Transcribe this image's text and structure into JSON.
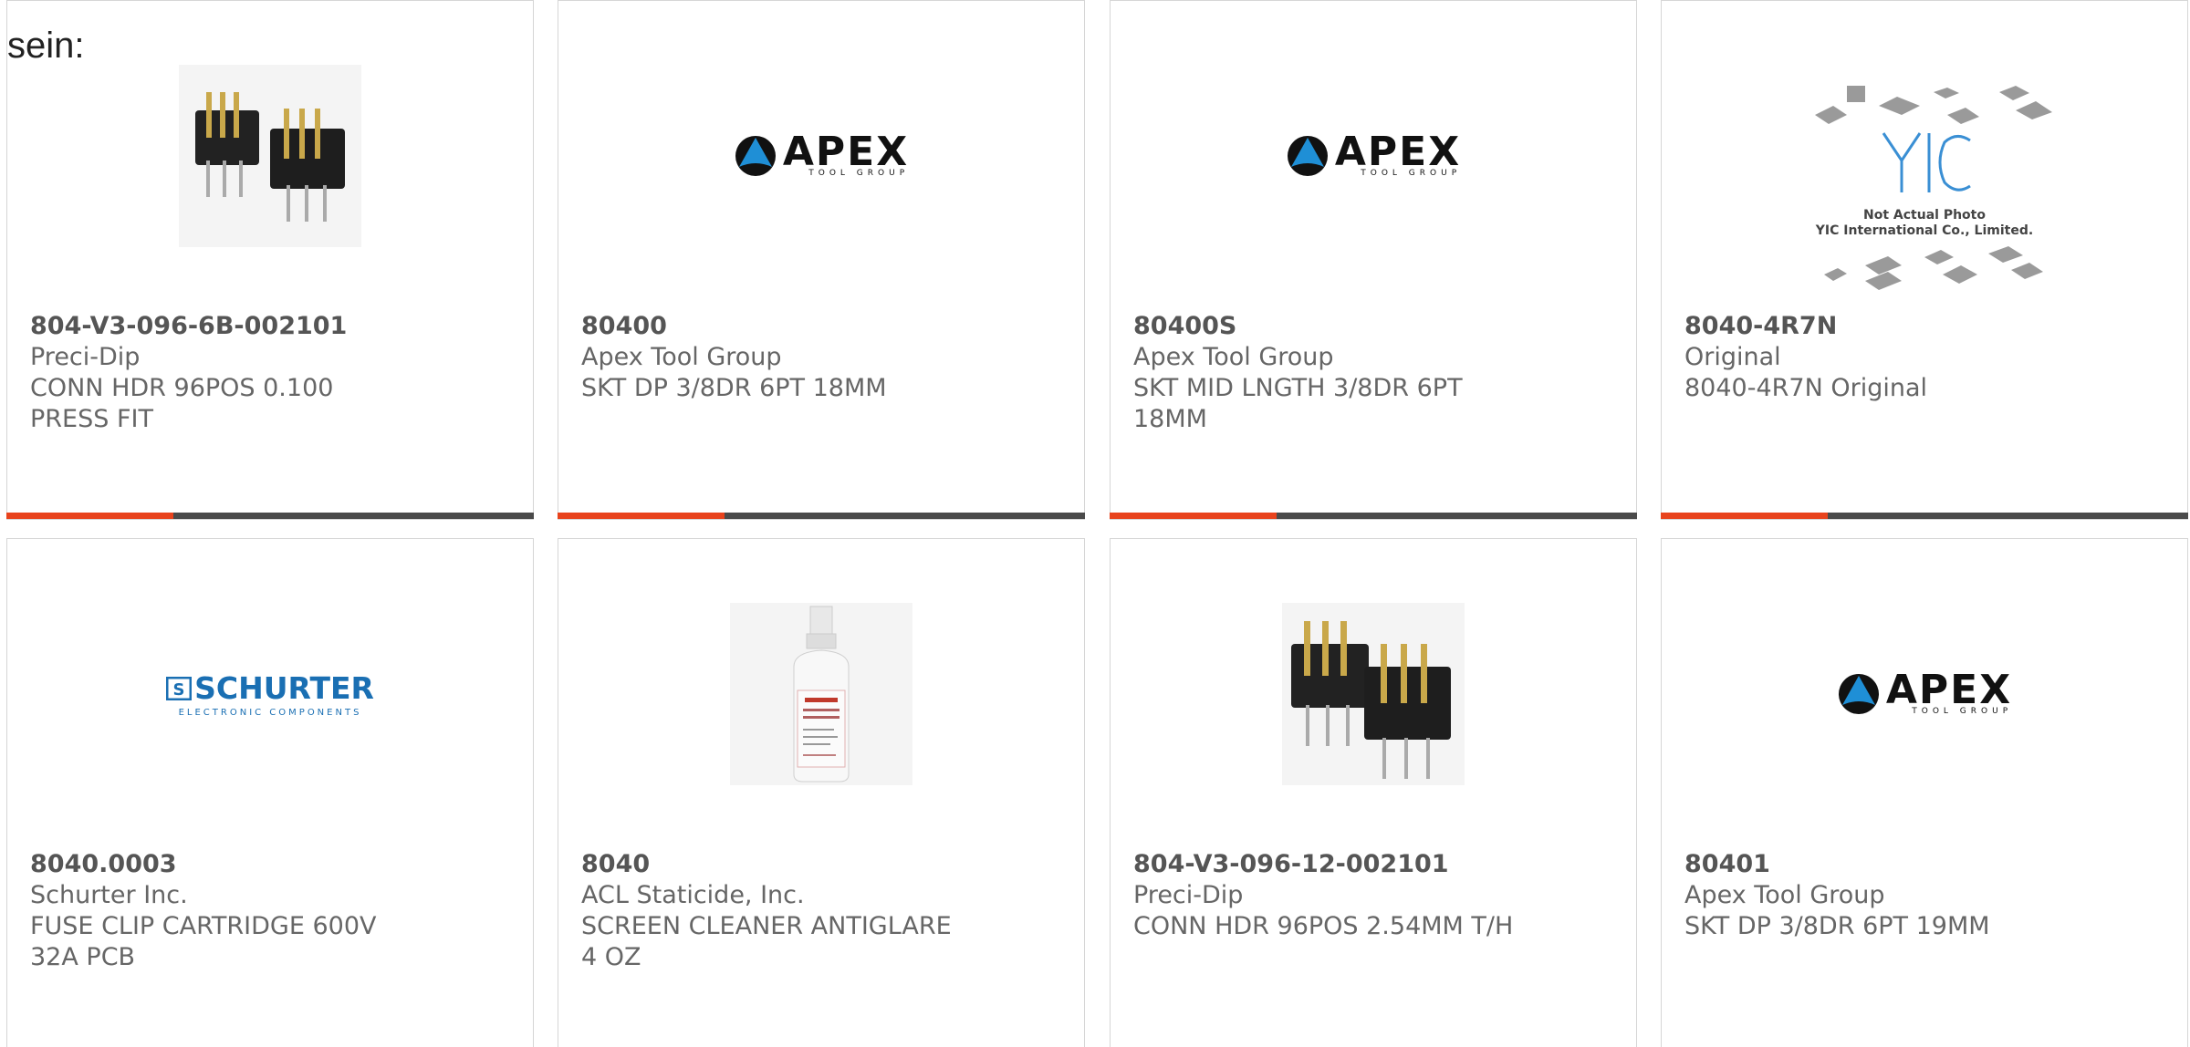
{
  "intro_text": "sein:",
  "colors": {
    "accent": "#e8431d",
    "bar": "#4a4a4a",
    "border": "#d6d6d6",
    "text": "#666666"
  },
  "products": [
    {
      "part_number": "804-V3-096-6B-002101",
      "manufacturer": "Preci-Dip",
      "description": "CONN HDR 96POS 0.100 PRESS FIT",
      "image": "connector-header-icon"
    },
    {
      "part_number": "80400",
      "manufacturer": "Apex Tool Group",
      "description": "SKT DP 3/8DR 6PT 18MM",
      "image": "apex-logo",
      "logo_text": "APEX",
      "logo_subtext": "TOOL GROUP"
    },
    {
      "part_number": "80400S",
      "manufacturer": "Apex Tool Group",
      "description": "SKT MID LNGTH 3/8DR 6PT 18MM",
      "image": "apex-logo",
      "logo_text": "APEX",
      "logo_subtext": "TOOL GROUP"
    },
    {
      "part_number": "8040-4R7N",
      "manufacturer": "Original",
      "description": "8040-4R7N Original",
      "image": "yic-placeholder",
      "logo_text": "YIC",
      "caption_line1": "Not Actual Photo",
      "caption_line2": "YIC International Co., Limited."
    },
    {
      "part_number": "8040.0003",
      "manufacturer": "Schurter Inc.",
      "description": "FUSE CLIP CARTRIDGE 600V 32A PCB",
      "image": "schurter-logo",
      "logo_text": "SCHURTER",
      "logo_subtext": "ELECTRONIC COMPONENTS"
    },
    {
      "part_number": "8040",
      "manufacturer": "ACL Staticide, Inc.",
      "description": "SCREEN CLEANER ANTIGLARE 4 OZ",
      "image": "spray-bottle-icon"
    },
    {
      "part_number": "804-V3-096-12-002101",
      "manufacturer": "Preci-Dip",
      "description": "CONN HDR 96POS 2.54MM T/H",
      "image": "connector-header-icon"
    },
    {
      "part_number": "80401",
      "manufacturer": "Apex Tool Group",
      "description": "SKT DP 3/8DR 6PT 19MM",
      "image": "apex-logo",
      "logo_text": "APEX",
      "logo_subtext": "TOOL GROUP"
    }
  ]
}
